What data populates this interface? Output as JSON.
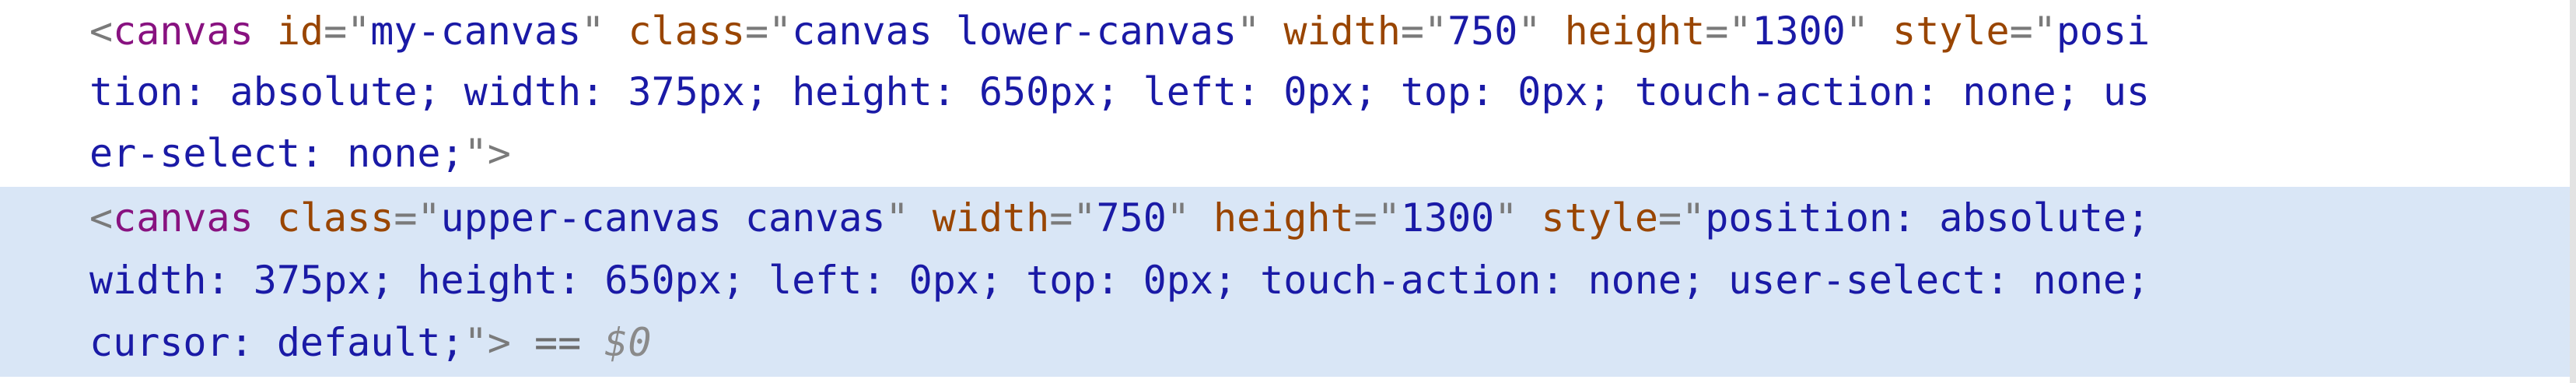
{
  "elements": [
    {
      "lines": [
        [
          {
            "t": "<",
            "c": "punct"
          },
          {
            "t": "canvas",
            "c": "tag"
          },
          {
            "t": " ",
            "c": "plain"
          },
          {
            "t": "id",
            "c": "attr"
          },
          {
            "t": "=\"",
            "c": "punct"
          },
          {
            "t": "my-canvas",
            "c": "val"
          },
          {
            "t": "\"",
            "c": "punct"
          },
          {
            "t": " ",
            "c": "plain"
          },
          {
            "t": "class",
            "c": "attr"
          },
          {
            "t": "=\"",
            "c": "punct"
          },
          {
            "t": "canvas lower-canvas",
            "c": "val"
          },
          {
            "t": "\"",
            "c": "punct"
          },
          {
            "t": " ",
            "c": "plain"
          },
          {
            "t": "width",
            "c": "attr"
          },
          {
            "t": "=\"",
            "c": "punct"
          },
          {
            "t": "750",
            "c": "val"
          },
          {
            "t": "\"",
            "c": "punct"
          },
          {
            "t": " ",
            "c": "plain"
          },
          {
            "t": "height",
            "c": "attr"
          },
          {
            "t": "=\"",
            "c": "punct"
          },
          {
            "t": "1300",
            "c": "val"
          },
          {
            "t": "\"",
            "c": "punct"
          },
          {
            "t": " ",
            "c": "plain"
          },
          {
            "t": "style",
            "c": "attr"
          },
          {
            "t": "=\"",
            "c": "punct"
          },
          {
            "t": "posi",
            "c": "val"
          }
        ],
        [
          {
            "t": "tion: absolute; width: 375px; height: 650px; left: 0px; top: 0px; touch-action: none; us",
            "c": "val"
          }
        ],
        [
          {
            "t": "er-select: none;",
            "c": "val"
          },
          {
            "t": "\">",
            "c": "punct"
          }
        ]
      ]
    },
    {
      "lines": [
        [
          {
            "t": "<",
            "c": "punct"
          },
          {
            "t": "canvas",
            "c": "tag"
          },
          {
            "t": " ",
            "c": "plain"
          },
          {
            "t": "class",
            "c": "attr"
          },
          {
            "t": "=\"",
            "c": "punct"
          },
          {
            "t": "upper-canvas canvas",
            "c": "val"
          },
          {
            "t": "\"",
            "c": "punct"
          },
          {
            "t": " ",
            "c": "plain"
          },
          {
            "t": "width",
            "c": "attr"
          },
          {
            "t": "=\"",
            "c": "punct"
          },
          {
            "t": "750",
            "c": "val"
          },
          {
            "t": "\"",
            "c": "punct"
          },
          {
            "t": " ",
            "c": "plain"
          },
          {
            "t": "height",
            "c": "attr"
          },
          {
            "t": "=\"",
            "c": "punct"
          },
          {
            "t": "1300",
            "c": "val"
          },
          {
            "t": "\"",
            "c": "punct"
          },
          {
            "t": " ",
            "c": "plain"
          },
          {
            "t": "style",
            "c": "attr"
          },
          {
            "t": "=\"",
            "c": "punct"
          },
          {
            "t": "position: absolute;",
            "c": "val"
          }
        ],
        [
          {
            "t": "width: 375px; height: 650px; left: 0px; top: 0px; touch-action: none; user-select: none;",
            "c": "val"
          }
        ],
        [
          {
            "t": "cursor: default;",
            "c": "val"
          },
          {
            "t": "\">",
            "c": "punct"
          },
          {
            "t": " == ",
            "c": "ref"
          },
          {
            "t": "$0",
            "c": "ref-var"
          }
        ]
      ]
    }
  ],
  "colors": {
    "tag": "#881280",
    "attribute": "#994500",
    "value": "#1a1aa6",
    "punctuation": "#7a7a7a",
    "selection_background": "#d9e6f6"
  }
}
